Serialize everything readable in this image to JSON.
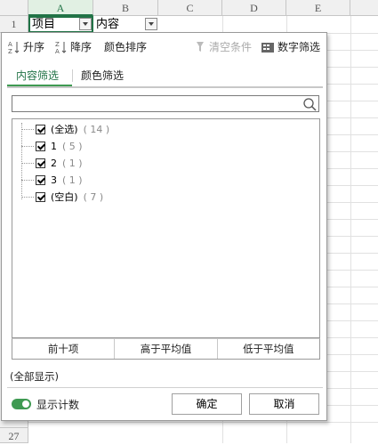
{
  "spreadsheet": {
    "columns": [
      "A",
      "B",
      "C",
      "D",
      "E"
    ],
    "rows": [
      "1",
      "27"
    ],
    "cells": {
      "A1": "项目",
      "B1": "内容"
    }
  },
  "filter_panel": {
    "toolbar": {
      "sort_asc": "升序",
      "sort_desc": "降序",
      "color_sort": "颜色排序",
      "clear_conditions": "清空条件",
      "number_filter": "数字筛选"
    },
    "tabs": [
      "内容筛选",
      "颜色筛选"
    ],
    "search_placeholder": "",
    "items": [
      {
        "label": "(全选)",
        "count": "( 14 )",
        "checked": true
      },
      {
        "label": "1",
        "count": "( 5 )",
        "checked": true
      },
      {
        "label": "2",
        "count": "( 1 )",
        "checked": true
      },
      {
        "label": "3",
        "count": "( 1 )",
        "checked": true
      },
      {
        "label": "(空白)",
        "count": "( 7 )",
        "checked": true
      }
    ],
    "quick_filters": [
      "前十项",
      "高于平均值",
      "低于平均值"
    ],
    "display_note": "(全部显示)",
    "show_count_label": "显示计数",
    "confirm": "确定",
    "cancel": "取消"
  },
  "colors": {
    "accent": "#217346",
    "toggle": "#3f9a52"
  }
}
